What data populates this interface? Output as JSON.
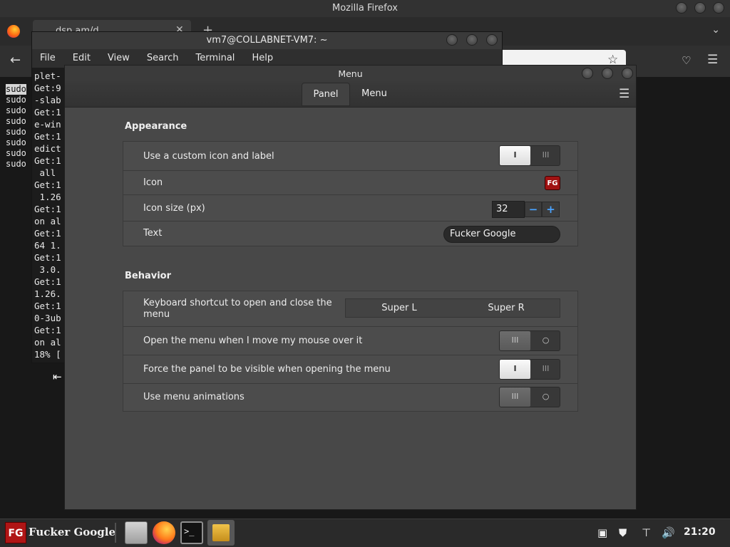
{
  "firefox": {
    "window_title": "Mozilla Firefox",
    "tab_title": "dsp.am/d",
    "close_glyph": "✕",
    "newtab_glyph": "+",
    "tablist_glyph": "⌄",
    "back_glyph": "←",
    "star_glyph": "☆",
    "pocket_glyph": "♡",
    "menu_glyph": "☰",
    "sudo_lines": [
      "sudo",
      "sudo",
      "sudo",
      "sudo",
      "sudo",
      "sudo",
      "sudo",
      "sudo"
    ]
  },
  "terminal": {
    "title": "vm7@COLLABNET-VM7: ~",
    "menu": [
      "File",
      "Edit",
      "View",
      "Search",
      "Terminal",
      "Help"
    ],
    "lines": [
      "plet-",
      "Get:9",
      "-slab",
      "Get:1",
      "e-win",
      "Get:1",
      "edict",
      "Get:1",
      " all ",
      "Get:1",
      " 1.26",
      "Get:1",
      "on al",
      "Get:1",
      "64 1.",
      "Get:1",
      " 3.0.",
      "Get:1",
      "1.26.",
      "Get:1",
      "0-3ub",
      "Get:1",
      "on al",
      "18% ["
    ]
  },
  "menu_window": {
    "title": "Menu",
    "tabs": [
      "Panel",
      "Menu"
    ],
    "hamburger_glyph": "☰",
    "appearance": {
      "title": "Appearance",
      "custom_icon_label": "Use a custom icon and label",
      "custom_icon_enabled": true,
      "icon_label": "Icon",
      "icon_badge": "FG",
      "icon_size_label": "Icon size (px)",
      "icon_size_value": "32",
      "minus_glyph": "−",
      "plus_glyph": "+",
      "text_label": "Text",
      "text_value": "Fucker Google"
    },
    "behavior": {
      "title": "Behavior",
      "shortcut_label": "Keyboard shortcut to open and close the menu",
      "shortcut_keys": [
        "Super L",
        "Super R"
      ],
      "hover_label": "Open the menu when I move my mouse over it",
      "hover_enabled": false,
      "force_panel_label": "Force the panel to be visible when opening the menu",
      "force_panel_enabled": true,
      "animations_label": "Use menu animations",
      "animations_enabled": false
    },
    "switch_glyphs": {
      "on": "I",
      "lines": "III",
      "circle": "○"
    }
  },
  "taskbar": {
    "menu_logo": "FG",
    "menu_label": "Fucker Google",
    "terminal_glyph": ">_",
    "tray_icons": [
      "clipboard-icon",
      "shield-icon",
      "network-icon",
      "volume-icon"
    ],
    "clock": "21:20"
  }
}
